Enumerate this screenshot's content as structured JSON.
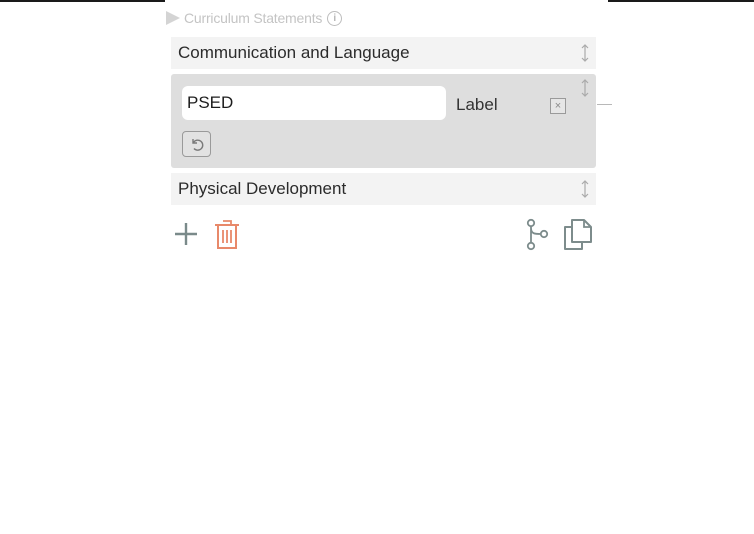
{
  "section": {
    "title": "Curriculum Statements",
    "caret_icon": "caret-right-icon",
    "info_icon": "info-icon",
    "info_glyph": "i"
  },
  "items": [
    {
      "label": "Communication and Language",
      "handle_icon": "drag-handle-icon"
    },
    {
      "label": "Physical Development",
      "handle_icon": "drag-handle-icon"
    }
  ],
  "editor": {
    "input_value": "PSED",
    "field_label": "Label",
    "clear_icon": "close-box-icon",
    "clear_glyph": "×",
    "undo_icon": "undo-icon",
    "handle_icon": "drag-handle-icon"
  },
  "toolbar": {
    "add_icon": "plus-icon",
    "delete_icon": "trash-icon",
    "branch_icon": "branch-icon",
    "copy_icon": "copy-icon"
  },
  "colors": {
    "add": "#7a8a8a",
    "delete": "#e8896a",
    "tools": "#7d8c8c",
    "header_text": "#c4c4c4",
    "row_bg": "#f3f3f3",
    "editor_bg": "#dedede"
  }
}
